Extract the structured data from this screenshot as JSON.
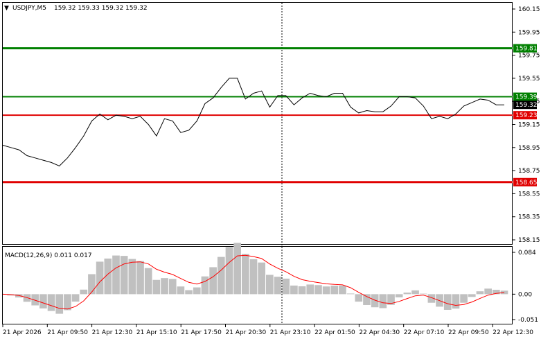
{
  "header": {
    "symbol_timeframe": "USDJPY,M5",
    "ohlc": "159.32 159.33 159.32 159.32"
  },
  "macd": {
    "label": "MACD(12,26,9) 0.011 0.017",
    "ticks": [
      "0.084",
      "0.00",
      "-0.051"
    ]
  },
  "price_axis": {
    "ticks": [
      "160.15",
      "159.95",
      "159.75",
      "159.55",
      "159.35",
      "159.15",
      "158.95",
      "158.75",
      "158.55",
      "158.35",
      "158.15"
    ]
  },
  "time_axis": {
    "labels": [
      "21 Apr 2026",
      "21 Apr 09:50",
      "21 Apr 12:30",
      "21 Apr 15:10",
      "21 Apr 17:50",
      "21 Apr 20:30",
      "21 Apr 23:10",
      "22 Apr 01:50",
      "22 Apr 04:30",
      "22 Apr 07:10",
      "22 Apr 09:50",
      "22 Apr 12:30"
    ]
  },
  "levels": [
    {
      "price": 159.81,
      "label": "159.81",
      "color": "#008000",
      "kind": "buy-target"
    },
    {
      "price": 159.39,
      "label": "159.39",
      "color": "#008000",
      "kind": "buy-entry"
    },
    {
      "price": 159.23,
      "label": "159.23",
      "color": "#e00000",
      "kind": "sell-entry"
    },
    {
      "price": 158.65,
      "label": "158.65",
      "color": "#e00000",
      "kind": "sell-target"
    }
  ],
  "current_price": {
    "price": 159.32,
    "label": "159.32",
    "color": "#000000"
  },
  "colors": {
    "price_line": "#000000",
    "histogram": "#c0c0c0",
    "signal": "#ff0000",
    "grid": "#000000"
  },
  "chart_data": {
    "type": "line",
    "series": [
      {
        "values": [
          158.97,
          158.95,
          158.93,
          158.88,
          158.86,
          158.84,
          158.82,
          158.79,
          158.86,
          158.95,
          159.05,
          159.18,
          159.24,
          159.19,
          159.23,
          159.22,
          159.2,
          159.22,
          159.15,
          159.05,
          159.2,
          159.18,
          159.08,
          159.1,
          159.18,
          159.33,
          159.38,
          159.47,
          159.55,
          159.55,
          159.37,
          159.42,
          159.44,
          159.3,
          159.4,
          159.4,
          159.32,
          159.38,
          159.42,
          159.4,
          159.39,
          159.42,
          159.42,
          159.3,
          159.25,
          159.27,
          159.26,
          159.26,
          159.31,
          159.39,
          159.39,
          159.38,
          159.31,
          159.2,
          159.22,
          159.2,
          159.24,
          159.31,
          159.34,
          159.37,
          159.36,
          159.32,
          159.32
        ]
      }
    ]
  }
}
